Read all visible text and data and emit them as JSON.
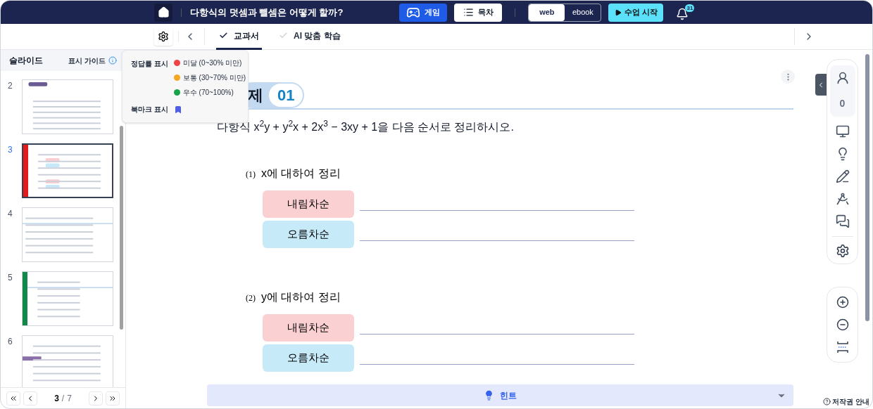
{
  "header": {
    "title": "다항식의 덧셈과 뺄셈은 어떻게 할까?",
    "buttons": [
      {
        "kind": "game",
        "label": "게임"
      },
      {
        "kind": "toc",
        "label": "목차"
      }
    ],
    "view_modes": [
      {
        "label": "web",
        "selected": true
      },
      {
        "label": "ebook",
        "selected": false
      }
    ],
    "start_button": "수업 시작",
    "notification_count": "31"
  },
  "tabs": [
    {
      "label": "교과서",
      "selected": true
    },
    {
      "label": "AI 맞춤 학습",
      "selected": false
    }
  ],
  "sidebar": {
    "title": "슬라이드",
    "guide_link": "표시 가이드",
    "slides": [
      {
        "number": "2",
        "selected": false,
        "kind": "intro"
      },
      {
        "number": "3",
        "selected": true,
        "kind": "exercise",
        "color": "#e31b1b"
      },
      {
        "number": "4",
        "selected": false,
        "kind": "lines"
      },
      {
        "number": "5",
        "selected": false,
        "kind": "formula",
        "color": "#12884a"
      },
      {
        "number": "6",
        "selected": false,
        "kind": "example"
      }
    ],
    "pagination": {
      "current": "3",
      "separator": "/",
      "total": "7"
    }
  },
  "guide_popover": {
    "answer_rate_label": "정답률 표시",
    "levels": [
      {
        "color": "#ef4444",
        "label": "미달 (0~30% 미만)"
      },
      {
        "color": "#f5a623",
        "label": "보통 (30~70% 미만)"
      },
      {
        "color": "#16a34a",
        "label": "우수 (70~100%)"
      }
    ],
    "bookmark_label": "북마크 표시"
  },
  "problem": {
    "title": "제",
    "number": "01",
    "statement": "다항식 x$^{2}$y + y$^{2}$x + 2x$^{3}$ − 3xy + 1을 다음 순서로 정리하시오.",
    "parts": [
      {
        "number": "(1)",
        "heading": "x에 대하여 정리",
        "answers": [
          {
            "kind": "descending",
            "label": "내림차순"
          },
          {
            "kind": "ascending",
            "label": "오름차순"
          }
        ]
      },
      {
        "number": "(2)",
        "heading": "y에 대하여 정리",
        "answers": [
          {
            "kind": "descending",
            "label": "내림차순"
          },
          {
            "kind": "ascending",
            "label": "오름차순"
          }
        ]
      }
    ]
  },
  "hint": "힌트",
  "toolbar": {
    "participant_count": "0"
  },
  "copyright": "저작권 안내"
}
